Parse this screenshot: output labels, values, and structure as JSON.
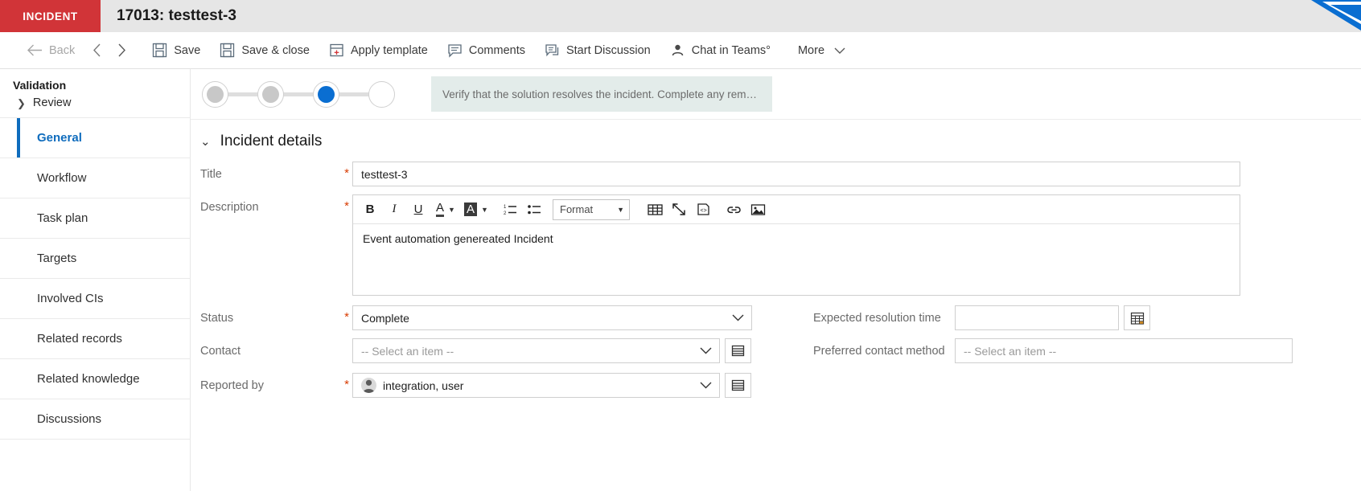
{
  "titlebar": {
    "record_type": "INCIDENT",
    "record_title": "17013: testtest-3"
  },
  "commandbar": {
    "back": "Back",
    "prev_icon": "chevron-left-icon",
    "next_icon": "chevron-right-icon",
    "items": [
      {
        "label": "Save",
        "icon": "save-icon"
      },
      {
        "label": "Save & close",
        "icon": "save-close-icon"
      },
      {
        "label": "Apply template",
        "icon": "template-icon"
      },
      {
        "label": "Comments",
        "icon": "comment-icon"
      },
      {
        "label": "Start Discussion",
        "icon": "discussion-icon"
      },
      {
        "label": "Chat in Teams°",
        "icon": "person-chat-icon"
      }
    ],
    "more": "More"
  },
  "leftnav": {
    "validation_label": "Validation",
    "review_label": "Review",
    "items": [
      {
        "label": "General",
        "active": true
      },
      {
        "label": "Workflow",
        "active": false
      },
      {
        "label": "Task plan",
        "active": false
      },
      {
        "label": "Targets",
        "active": false
      },
      {
        "label": "Involved CIs",
        "active": false
      },
      {
        "label": "Related records",
        "active": false
      },
      {
        "label": "Related knowledge",
        "active": false
      },
      {
        "label": "Discussions",
        "active": false
      }
    ]
  },
  "stepper": {
    "steps": [
      {
        "state": "done"
      },
      {
        "state": "done"
      },
      {
        "state": "current"
      },
      {
        "state": "future"
      }
    ],
    "callout_text": "Verify that the solution resolves the incident. Complete any remaining…"
  },
  "section": {
    "title": "Incident details",
    "collapse_icon": "chevron-down-icon"
  },
  "form": {
    "title_field": {
      "label": "Title",
      "required": true,
      "value": "testtest-3"
    },
    "description_field": {
      "label": "Description",
      "required": true,
      "content": "Event automation genereated Incident",
      "toolbar": {
        "bold": "B",
        "italic": "I",
        "underline": "U",
        "font_color": "A",
        "highlight": "A",
        "numbered_list": "numbered-list-icon",
        "bullet_list": "bullet-list-icon",
        "format_label": "Format",
        "table": "table-icon",
        "maximize": "maximize-icon",
        "source": "source-code-icon",
        "link": "link-icon",
        "image": "image-icon"
      }
    },
    "status_field": {
      "label": "Status",
      "required": true,
      "value": "Complete"
    },
    "contact_field": {
      "label": "Contact",
      "required": false,
      "placeholder": "-- Select an item --",
      "lookup_icon": "lookup-icon"
    },
    "reported_by_field": {
      "label": "Reported by",
      "required": true,
      "value": "integration, user",
      "avatar_icon": "person-avatar-icon",
      "lookup_icon": "lookup-icon"
    },
    "expected_resolution_field": {
      "label": "Expected resolution time",
      "required": false,
      "value": "",
      "calendar_icon": "calendar-icon"
    },
    "preferred_contact_field": {
      "label": "Preferred contact method",
      "required": false,
      "placeholder": "-- Select an item --"
    }
  },
  "colors": {
    "accent": "#0f6cbd",
    "record_type_bg": "#d13438",
    "required_marker": "#d83b01",
    "callout_bg": "#e3ecea",
    "step_current": "#0a6ed1"
  }
}
